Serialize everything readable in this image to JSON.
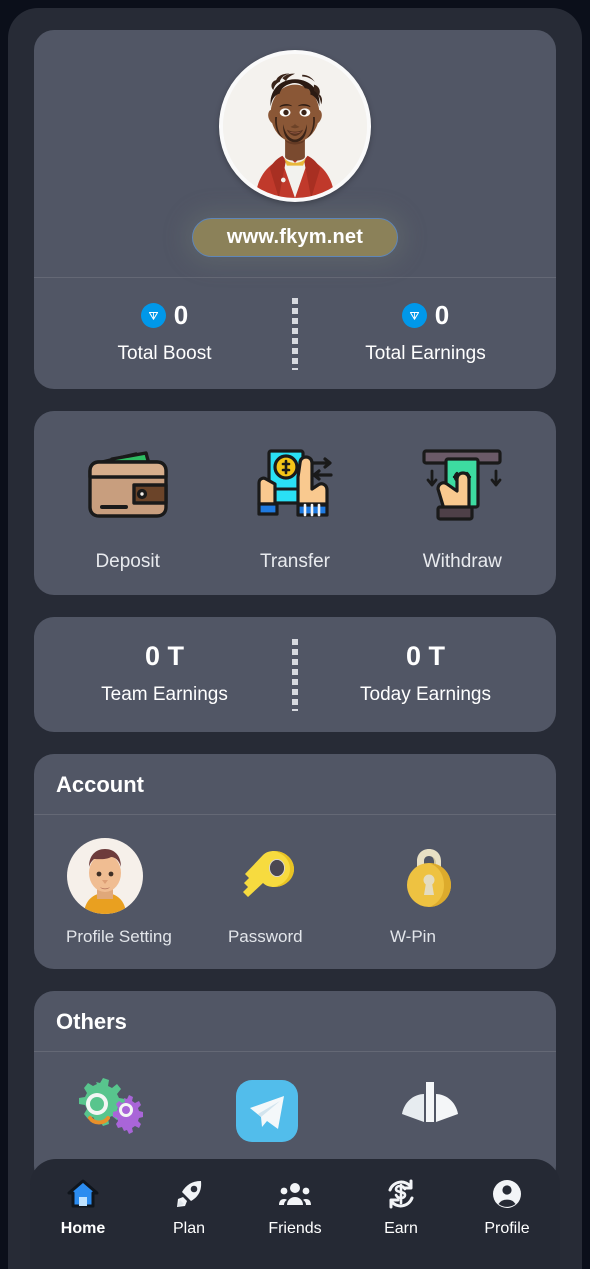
{
  "profile": {
    "avatar_alt": "user-avatar-illustration",
    "url_badge": "www.fkym.net"
  },
  "stats": [
    {
      "icon": "ton-coin-icon",
      "value": "0",
      "label": "Total Boost"
    },
    {
      "icon": "ton-coin-icon",
      "value": "0",
      "label": "Total Earnings"
    }
  ],
  "actions": [
    {
      "icon": "wallet-icon",
      "label": "Deposit"
    },
    {
      "icon": "transfer-icon",
      "label": "Transfer"
    },
    {
      "icon": "atm-withdraw-icon",
      "label": "Withdraw"
    }
  ],
  "earnings": [
    {
      "value": "0 T",
      "label": "Team Earnings"
    },
    {
      "value": "0 T",
      "label": "Today Earnings"
    }
  ],
  "account": {
    "title": "Account",
    "items": [
      {
        "icon": "profile-avatar-icon",
        "label": "Profile Setting"
      },
      {
        "icon": "key-icon",
        "label": "Password"
      },
      {
        "icon": "padlock-icon",
        "label": "W-Pin"
      }
    ]
  },
  "others": {
    "title": "Others",
    "items": [
      {
        "icon": "gears-settings-icon",
        "label": ""
      },
      {
        "icon": "telegram-icon",
        "label": ""
      },
      {
        "icon": "fan-blades-icon",
        "label": ""
      }
    ]
  },
  "bottom_nav": {
    "items": [
      {
        "icon": "home-icon",
        "label": "Home",
        "active": true
      },
      {
        "icon": "rocket-icon",
        "label": "Plan",
        "active": false
      },
      {
        "icon": "friends-icon",
        "label": "Friends",
        "active": false
      },
      {
        "icon": "earn-icon",
        "label": "Earn",
        "active": false
      },
      {
        "icon": "profile-icon",
        "label": "Profile",
        "active": false
      }
    ]
  },
  "colors": {
    "page_background": "#0b0f1a",
    "app_background": "#272b36",
    "card_background": "#515665",
    "nav_background": "#252934",
    "accent_ton_blue": "#0098ea",
    "badge_khaki": "#8b8159",
    "badge_border_blue": "#5f86b8",
    "active_nav_blue": "#2b8cf0",
    "text_primary": "#ffffff"
  }
}
